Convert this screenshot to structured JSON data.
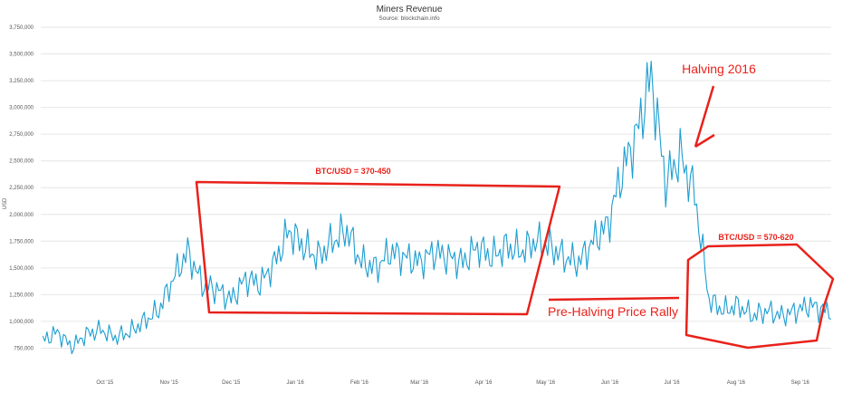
{
  "chart_data": {
    "type": "line",
    "title": "Miners Revenue",
    "subtitle": "Source: blockchain.info",
    "ylabel": "USD",
    "ylim": [
      500000,
      3750000
    ],
    "yticks": [
      "750,000",
      "1,000,000",
      "1,250,000",
      "1,500,000",
      "1,750,000",
      "2,000,000",
      "2,250,000",
      "2,500,000",
      "2,750,000",
      "3,000,000",
      "3,250,000",
      "3,500,000",
      "3,750,000"
    ],
    "xticks": [
      "Oct '15",
      "Nov '15",
      "Dec '15",
      "Jan '16",
      "Feb '16",
      "Mar '16",
      "Apr '16",
      "May '16",
      "Jun '16",
      "Jul '16",
      "Aug '16",
      "Sep '16"
    ],
    "x": [
      "2015-09-01",
      "2015-09-08",
      "2015-09-15",
      "2015-09-22",
      "2015-09-29",
      "2015-10-06",
      "2015-10-13",
      "2015-10-20",
      "2015-10-27",
      "2015-11-03",
      "2015-11-10",
      "2015-11-17",
      "2015-11-24",
      "2015-12-01",
      "2015-12-08",
      "2015-12-15",
      "2015-12-22",
      "2015-12-29",
      "2016-01-05",
      "2016-01-12",
      "2016-01-19",
      "2016-01-26",
      "2016-02-02",
      "2016-02-09",
      "2016-02-16",
      "2016-02-23",
      "2016-03-01",
      "2016-03-08",
      "2016-03-15",
      "2016-03-22",
      "2016-03-29",
      "2016-04-05",
      "2016-04-12",
      "2016-04-19",
      "2016-04-26",
      "2016-05-03",
      "2016-05-10",
      "2016-05-17",
      "2016-05-24",
      "2016-05-31",
      "2016-06-07",
      "2016-06-14",
      "2016-06-21",
      "2016-06-28",
      "2016-07-05",
      "2016-07-12",
      "2016-07-19",
      "2016-07-26",
      "2016-08-02",
      "2016-08-09",
      "2016-08-16",
      "2016-08-23",
      "2016-08-30",
      "2016-09-06",
      "2016-09-13"
    ],
    "series": [
      {
        "values": [
          820000,
          900000,
          760000,
          880000,
          920000,
          850000,
          900000,
          1000000,
          1100000,
          1400000,
          1650000,
          1350000,
          1300000,
          1200000,
          1400000,
          1350000,
          1550000,
          1850000,
          1700000,
          1600000,
          1750000,
          1850000,
          1550000,
          1500000,
          1650000,
          1600000,
          1550000,
          1650000,
          1600000,
          1550000,
          1700000,
          1600000,
          1700000,
          1650000,
          1750000,
          1700000,
          1600000,
          1550000,
          1750000,
          1900000,
          2400000,
          2750000,
          3300000,
          2300000,
          2550000,
          2200000,
          1200000,
          1100000,
          1150000,
          1050000,
          1100000,
          1050000,
          1100000,
          1150000,
          1100000
        ]
      }
    ],
    "annotations": [
      {
        "text": "BTC/USD = 370-450"
      },
      {
        "text": "BTC/USD = 570-620"
      },
      {
        "text": "Halving 2016"
      },
      {
        "text": "Pre-Halving Price Rally"
      }
    ],
    "colors": {
      "series": "#1c9ed1",
      "annotation": "#e8221b",
      "grid": "#e6e6e6"
    },
    "grid": true,
    "legend": "none"
  }
}
